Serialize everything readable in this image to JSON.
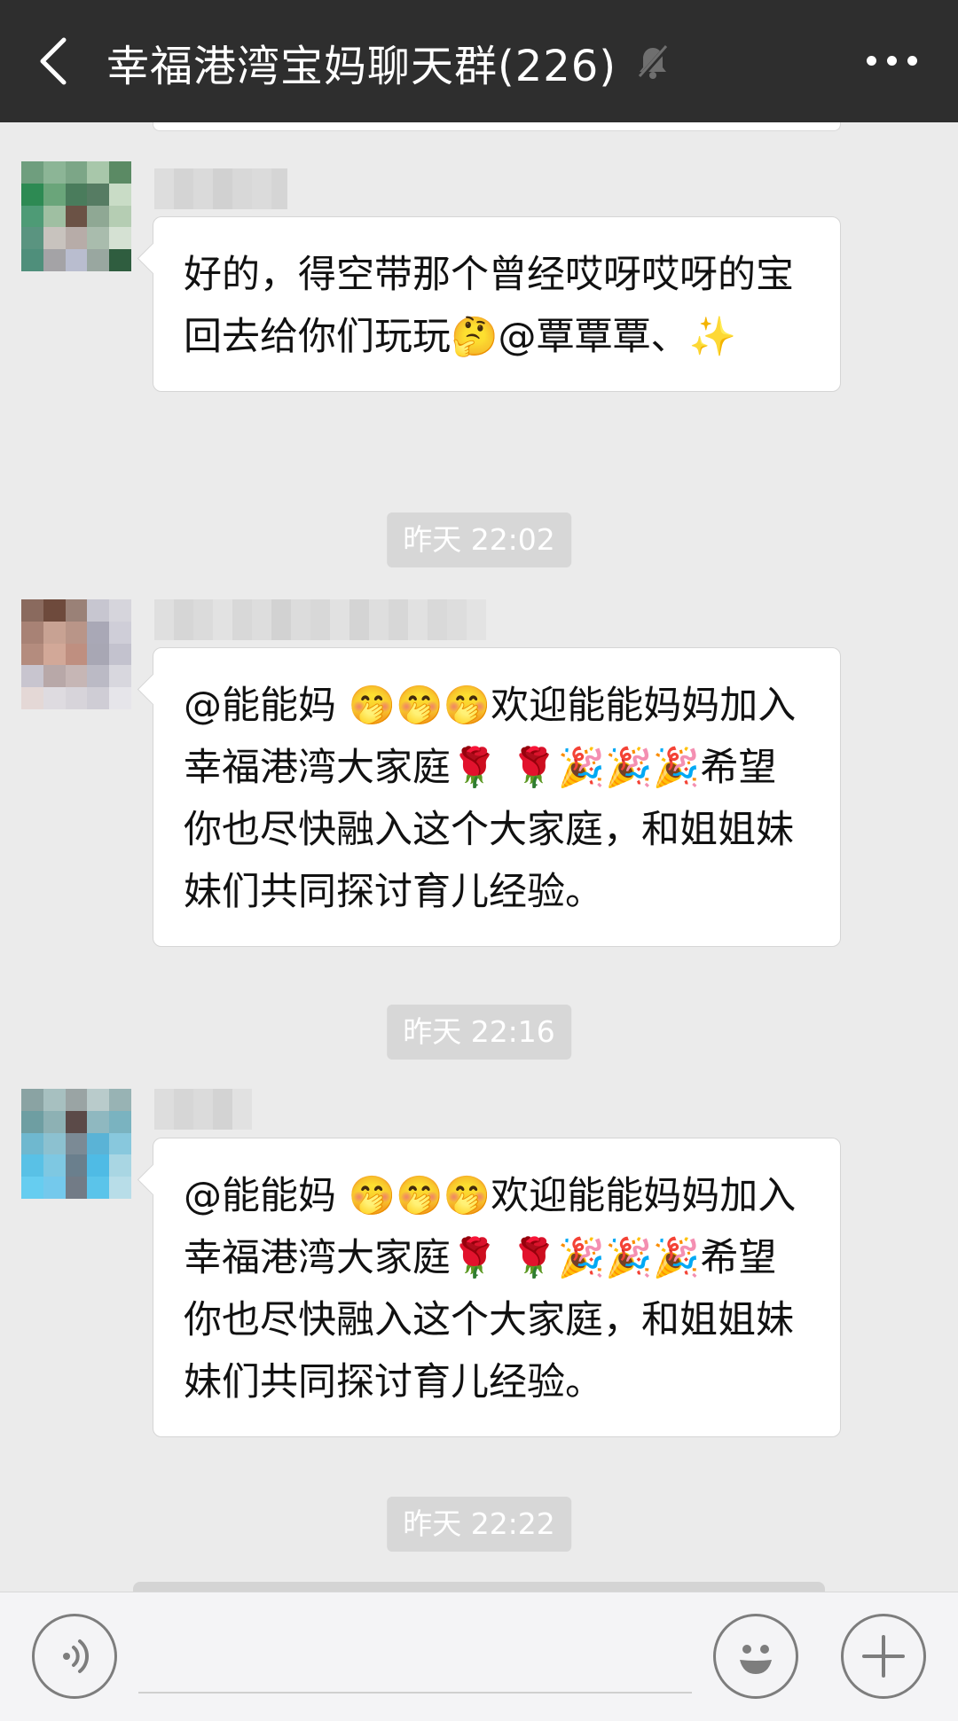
{
  "header": {
    "back_icon": "chevron-left-icon",
    "title": "幸福港湾宝妈聊天群(226)",
    "mute_icon": "bell-off-icon",
    "more_icon": "more-horizontal-icon"
  },
  "messages": [
    {
      "sender_blurred": true,
      "text": "好的，得空带那个曾经哎呀哎呀的宝回去给你们玩玩🤔@覃覃覃、✨"
    },
    {
      "time": "昨天 22:02",
      "sender_blurred": true,
      "text": "@能能妈 🤭🤭🤭欢迎能能妈妈加入幸福港湾大家庭🌹 🌹🎉🎉🎉希望你也尽快融入这个大家庭，和姐姐妹妹们共同探讨育儿经验。"
    },
    {
      "time": "昨天 22:16",
      "sender_blurred": true,
      "text": "@能能妈 🤭🤭🤭欢迎能能妈妈加入幸福港湾大家庭🌹 🌹🎉🎉🎉希望你也尽快融入这个大家庭，和姐姐妹妹们共同探讨育儿经验。"
    },
    {
      "time": "昨天 22:22"
    }
  ],
  "inputbar": {
    "voice_icon": "voice-input-icon",
    "emoji_icon": "emoji-face-icon",
    "plus_icon": "plus-icon",
    "message_value": ""
  },
  "colors": {
    "header_bg": "#2e2e2e",
    "chat_bg": "#ebebeb",
    "bubble_bg": "#ffffff",
    "timestamp_bg": "#d7d7d7",
    "inputbar_bg": "#f4f4f6"
  }
}
